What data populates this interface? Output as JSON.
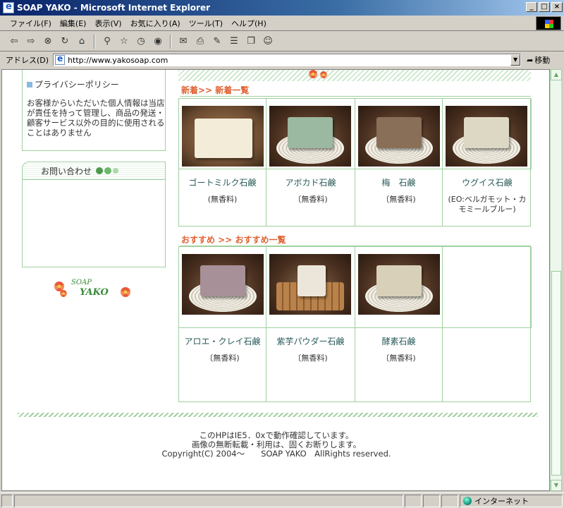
{
  "window": {
    "title": "SOAP YAKO - Microsoft Internet Explorer",
    "min_glyph": "_",
    "max_glyph": "□",
    "close_glyph": "×"
  },
  "menu": [
    "ファイル(F)",
    "編集(E)",
    "表示(V)",
    "お気に入り(A)",
    "ツール(T)",
    "ヘルプ(H)"
  ],
  "toolbar_icons": [
    "back-icon",
    "forward-icon",
    "stop-icon",
    "refresh-icon",
    "home-icon",
    "search-icon",
    "favorites-icon",
    "history-icon",
    "mail-icon",
    "print-icon",
    "edit-icon",
    "discuss-icon",
    "messenger-icon"
  ],
  "address": {
    "label": "アドレス(D)",
    "url": "http://www.yakosoap.com",
    "go_label": "移動"
  },
  "sidebar": {
    "privacy_title": "プライバシーポリシー",
    "privacy_text": "お客様からいただいた個人情報は当店が責任を持って管理し、商品の発送・顧客サービス以外の目的に使用されることはありません",
    "contact_title": "お問い合わせ",
    "logo_top": "SOAP",
    "logo_bottom": "YAKO"
  },
  "new_section": {
    "title": "新着>> 新着一覧",
    "products": [
      {
        "name": "ゴートミルク石鹸",
        "note": "(無香料)",
        "soap_color": "#f3ecd8"
      },
      {
        "name": "アボカド石鹸",
        "note": "〔無香料)",
        "soap_color": "#9bb8a0"
      },
      {
        "name": "梅　石鹸",
        "note": "〔無香料)",
        "soap_color": "#8a6f58"
      },
      {
        "name": "ウグイス石鹸",
        "note": "(EO:ベルガモット・カモミールブルー)",
        "soap_color": "#ddd8c4"
      }
    ]
  },
  "recommend_section": {
    "title": "おすすめ >> おすすめ一覧",
    "products": [
      {
        "name": "アロエ・クレイ石鹸",
        "note": "〔無香料)",
        "soap_color": "#a89098"
      },
      {
        "name": "紫芋パウダー石鹸",
        "note": "〔無香料)",
        "soap_color": "#ece6da"
      },
      {
        "name": "酵素石鹸",
        "note": "〔無香料)",
        "soap_color": "#d8d0b8"
      }
    ]
  },
  "footer": {
    "line1": "このHPはIE5．0xで動作確認しています。",
    "line2": "画像の無断転載・利用は、固くお断りします。",
    "line3": "Copyright(C) 2004～　　SOAP YAKO　AllRights reserved."
  },
  "status": {
    "zone": "インターネット"
  },
  "colors": {
    "accent_orange": "#e06030",
    "border_green": "#9fd09f"
  }
}
